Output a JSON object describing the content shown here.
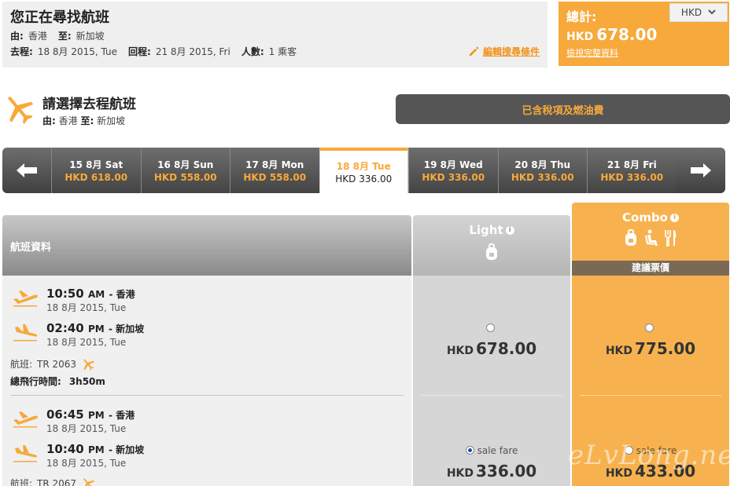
{
  "search": {
    "title": "您正在尋找航班",
    "from_label": "由:",
    "from_value": "香港",
    "to_label": "至:",
    "to_value": "新加坡",
    "depart_label": "去程:",
    "depart_value": "18 8月 2015, Tue",
    "return_label": "回程:",
    "return_value": "21 8月 2015, Fri",
    "pax_label": "人數:",
    "pax_value": "1 乘客",
    "edit_label": "編輯搜尋條件"
  },
  "total": {
    "label": "總計:",
    "currency": "HKD",
    "amount": "678.00",
    "detail_link": "檢視完整資料",
    "currency_select": "HKD"
  },
  "select": {
    "title": "請選擇去程航班",
    "from_label": "由:",
    "from_value": "香港",
    "to_label": "至:",
    "to_value": "新加坡",
    "tax_note": "已含稅項及燃油費"
  },
  "dates": [
    {
      "day": "15 8月 Sat",
      "price": "HKD 618.00"
    },
    {
      "day": "16 8月 Sun",
      "price": "HKD 558.00"
    },
    {
      "day": "17 8月 Mon",
      "price": "HKD 558.00"
    },
    {
      "day": "18 8月 Tue",
      "price": "HKD 336.00"
    },
    {
      "day": "19 8月 Wed",
      "price": "HKD 336.00"
    },
    {
      "day": "20 8月 Thu",
      "price": "HKD 336.00"
    },
    {
      "day": "21 8月 Fri",
      "price": "HKD 336.00"
    }
  ],
  "table": {
    "info_header": "航班資料",
    "light_name": "Light",
    "combo_name": "Combo",
    "recommended": "建議票價",
    "flight_label": "航班:",
    "duration_label": "總飛行時間:"
  },
  "flights": [
    {
      "dep_time": "10:50",
      "dep_ap": "AM",
      "dep_city": "香港",
      "dep_date": "18 8月 2015, Tue",
      "arr_time": "02:40",
      "arr_ap": "PM",
      "arr_city": "新加坡",
      "arr_date": "18 8月 2015, Tue",
      "flight_no": "TR 2063",
      "duration": "3h50m",
      "light_sale": "",
      "light_cur": "HKD",
      "light_price": "678.00",
      "combo_sale": "",
      "combo_cur": "HKD",
      "combo_price": "775.00"
    },
    {
      "dep_time": "06:45",
      "dep_ap": "PM",
      "dep_city": "香港",
      "dep_date": "18 8月 2015, Tue",
      "arr_time": "10:40",
      "arr_ap": "PM",
      "arr_city": "新加坡",
      "arr_date": "18 8月 2015, Tue",
      "flight_no": "TR 2067",
      "light_sale": "sale fare",
      "light_cur": "HKD",
      "light_price": "336.00",
      "combo_sale": "sale fare",
      "combo_cur": "HKD",
      "combo_price": "433.00"
    }
  ],
  "watermark": "eLvLong.net",
  "colors": {
    "accent": "#f7a93b",
    "dark": "#555555"
  }
}
